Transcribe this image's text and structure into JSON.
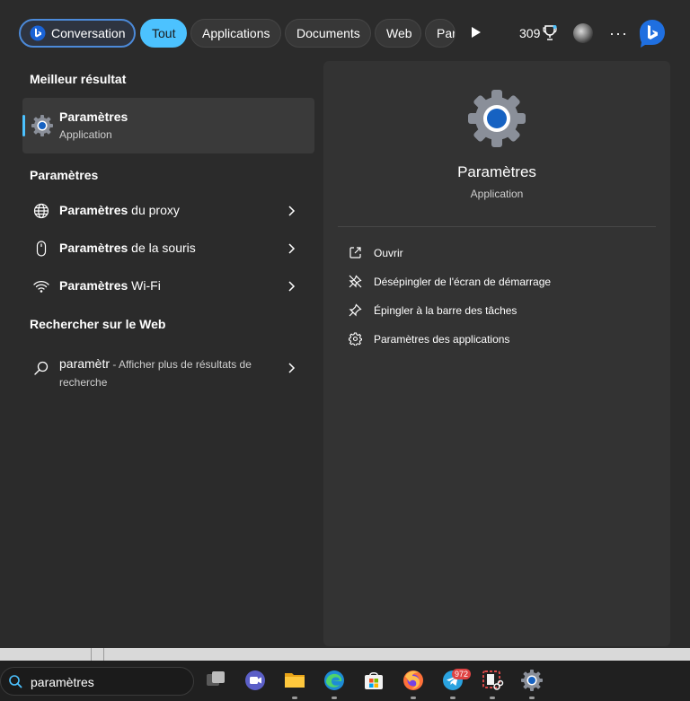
{
  "top_bar": {
    "tabs": [
      {
        "label": "Conversation"
      },
      {
        "label": "Tout",
        "active": true
      },
      {
        "label": "Applications"
      },
      {
        "label": "Documents"
      },
      {
        "label": "Web"
      },
      {
        "label": "Para"
      }
    ],
    "score": "309",
    "icons": [
      "bing-icon",
      "play-icon",
      "trophy-icon",
      "avatar",
      "more-icon",
      "bing-icon"
    ]
  },
  "best_match": {
    "heading": "Meilleur résultat",
    "name_bold": "Paramètres",
    "type": "Application",
    "icon": "settings-gear-icon"
  },
  "settings_section": {
    "heading": "Paramètres",
    "items": [
      {
        "bold": "Paramètres",
        "rest": " du proxy",
        "icon": "globe-icon"
      },
      {
        "bold": "Paramètres",
        "rest": " de la souris",
        "icon": "mouse-icon"
      },
      {
        "bold": "Paramètres",
        "rest": " Wi-Fi",
        "icon": "wifi-icon"
      }
    ]
  },
  "web_section": {
    "heading": "Rechercher sur le Web",
    "query": "paramètr",
    "hint": " - Afficher plus de résultats de recherche",
    "icon": "search-icon"
  },
  "detail": {
    "title": "Paramètres",
    "subtitle": "Application",
    "actions": [
      {
        "label": "Ouvrir",
        "icon": "open-external-icon"
      },
      {
        "label": "Désépingler de l'écran de démarrage",
        "icon": "unpin-icon"
      },
      {
        "label": "Épingler à la barre des tâches",
        "icon": "pin-icon"
      },
      {
        "label": "Paramètres des applications",
        "icon": "gear-icon"
      }
    ]
  },
  "taskbar": {
    "search_value": "paramètres",
    "telegram_badge": "972",
    "apps": [
      "task-view-icon",
      "meet-icon",
      "file-explorer-icon",
      "edge-icon",
      "store-icon",
      "firefox-icon",
      "telegram-icon",
      "snipping-tool-icon",
      "settings-icon"
    ]
  },
  "colors": {
    "accent": "#4cc2ff",
    "panel_bg": "#2b2b2b",
    "detail_bg": "#333333"
  }
}
